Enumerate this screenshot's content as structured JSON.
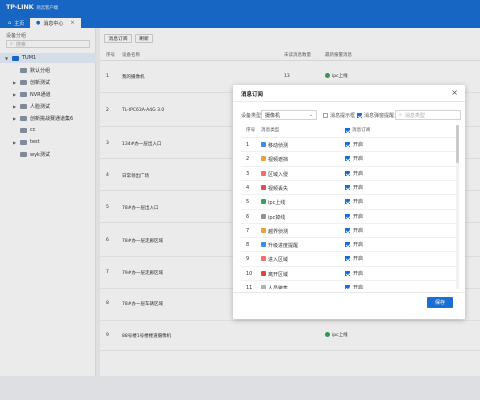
{
  "app": {
    "brand": "TP-LINK",
    "subtitle": "商云客户端"
  },
  "tabs": [
    {
      "label": "主页"
    },
    {
      "label": "消息中心"
    }
  ],
  "sidebar": {
    "title": "设备分组",
    "search_placeholder": "搜索",
    "items": [
      {
        "label": "TUM1"
      },
      {
        "label": "默认分组"
      },
      {
        "label": "创新测试"
      },
      {
        "label": "NVR通道"
      },
      {
        "label": "人脸测试"
      },
      {
        "label": "创新挑战赛通道集6"
      },
      {
        "label": "cc"
      },
      {
        "label": "test"
      },
      {
        "label": "wyk测试"
      }
    ]
  },
  "toolbar": {
    "subscribe_label": "消息订阅",
    "refresh_label": "刷新"
  },
  "table": {
    "headers": [
      "序号",
      "设备名称",
      "未读消息数量",
      "最新报警消息"
    ],
    "rows": [
      {
        "idx": "1",
        "name": "我的摄像机",
        "count": "13",
        "latest": "ipc上线"
      },
      {
        "idx": "2",
        "name": "TL-IPC63A-A4G 3.0",
        "count": "",
        "latest": ""
      },
      {
        "idx": "3",
        "name": "134#办一层出入口",
        "count": "",
        "latest": ""
      },
      {
        "idx": "4",
        "name": "日常领出广场",
        "count": "",
        "latest": ""
      },
      {
        "idx": "5",
        "name": "78#办一层出入口",
        "count": "",
        "latest": ""
      },
      {
        "idx": "6",
        "name": "78#办一层走廊区域",
        "count": "",
        "latest": ""
      },
      {
        "idx": "7",
        "name": "79#办一层走廊区域",
        "count": "",
        "latest": ""
      },
      {
        "idx": "8",
        "name": "78#办一层车辆区域",
        "count": "",
        "latest": ""
      },
      {
        "idx": "9",
        "name": "88号楼1号楼楼道摄像机",
        "count": "",
        "latest": "ipc上线"
      }
    ]
  },
  "dialog": {
    "title": "消息订阅",
    "device_type_label": "设备类型",
    "device_type_value": "摄像机",
    "show_subscribed_label": "消息提示框",
    "sound_label": "消息弹窗提醒",
    "search_placeholder": "消息类型",
    "col_index": "序号",
    "col_type": "消息类型",
    "col_subscribe": "消息订阅",
    "save_label": "保存",
    "rows": [
      {
        "idx": "1",
        "type": "移动侦测",
        "state": "开启",
        "color": "#3a8ee6"
      },
      {
        "idx": "2",
        "type": "视频遮挡",
        "state": "开启",
        "color": "#e6a23c"
      },
      {
        "idx": "3",
        "type": "区域入侵",
        "state": "开启",
        "color": "#f56c6c"
      },
      {
        "idx": "4",
        "type": "视频丢失",
        "state": "开启",
        "color": "#d9534f"
      },
      {
        "idx": "5",
        "type": "ipc上线",
        "state": "开启",
        "color": "#3aa35a"
      },
      {
        "idx": "6",
        "type": "ipc掉线",
        "state": "开启",
        "color": "#909399"
      },
      {
        "idx": "7",
        "type": "越界侦测",
        "state": "开启",
        "color": "#e6a23c"
      },
      {
        "idx": "8",
        "type": "升级进度提醒",
        "state": "开启",
        "color": "#3a8ee6"
      },
      {
        "idx": "9",
        "type": "进入区域",
        "state": "开启",
        "color": "#f56c6c"
      },
      {
        "idx": "10",
        "type": "离开区域",
        "state": "开启",
        "color": "#e64242"
      },
      {
        "idx": "11",
        "type": "人员聚集",
        "state": "开启",
        "color": "#b0b0b0"
      }
    ]
  },
  "colors": {
    "accent": "#1a6fd4"
  }
}
